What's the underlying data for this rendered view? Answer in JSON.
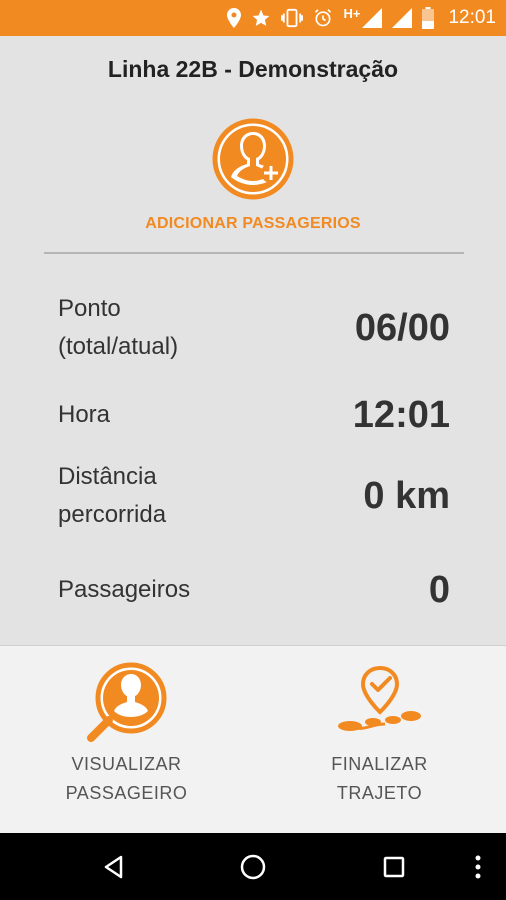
{
  "status_bar": {
    "time": "12:01",
    "network": "H+",
    "icons": [
      "location-icon",
      "star-icon",
      "vibrate-icon",
      "alarm-icon",
      "signal-icon",
      "wifi-icon",
      "battery-icon"
    ]
  },
  "header": {
    "title": "Linha 22B - Demonstração"
  },
  "add_passengers": {
    "label": "ADICIONAR PASSAGERIOS",
    "icon": "add-person-icon"
  },
  "stats": [
    {
      "label": "Ponto\n(total/atual)",
      "value": "06/00"
    },
    {
      "label": "Hora",
      "value": "12:01"
    },
    {
      "label": "Distância\npercorrida",
      "value": "0 km"
    },
    {
      "label": "Passageiros",
      "value": "0"
    }
  ],
  "bottom_actions": {
    "view_passenger": {
      "label": "VISUALIZAR\nPASSAGEIRO",
      "icon": "search-person-icon"
    },
    "finish_route": {
      "label": "FINALIZAR\nTRAJETO",
      "icon": "route-check-icon"
    }
  },
  "nav": {
    "icons": [
      "back-icon",
      "home-icon",
      "recents-icon",
      "more-icon"
    ]
  },
  "colors": {
    "accent": "#f28a22",
    "background": "#e3e3e3",
    "panel": "#f2f2f2"
  }
}
